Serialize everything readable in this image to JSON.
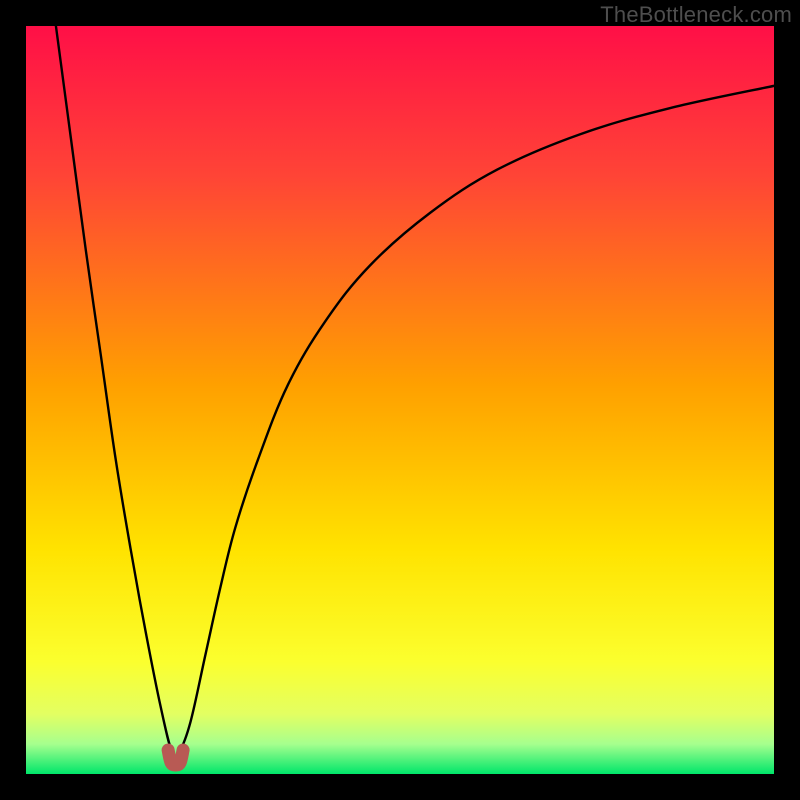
{
  "watermark": "TheBottleneck.com",
  "chart_data": {
    "type": "line",
    "title": "",
    "xlabel": "",
    "ylabel": "",
    "xlim": [
      0,
      100
    ],
    "ylim": [
      0,
      100
    ],
    "grid": false,
    "legend": false,
    "background_gradient_stops": [
      {
        "pct": 0,
        "color": "#ff0f47"
      },
      {
        "pct": 20,
        "color": "#ff4436"
      },
      {
        "pct": 48,
        "color": "#ffa000"
      },
      {
        "pct": 70,
        "color": "#ffe300"
      },
      {
        "pct": 85,
        "color": "#fbff2e"
      },
      {
        "pct": 92,
        "color": "#e3ff62"
      },
      {
        "pct": 96,
        "color": "#a6ff8e"
      },
      {
        "pct": 100,
        "color": "#00e66a"
      }
    ],
    "series": [
      {
        "name": "bottleneck-curve",
        "color": "#000000",
        "x": [
          4,
          6,
          8,
          10,
          12,
          14,
          16,
          18,
          19.5,
          20.5,
          22,
          24,
          26,
          28,
          31,
          35,
          40,
          46,
          54,
          63,
          74,
          86,
          100
        ],
        "y": [
          100,
          85,
          70,
          56,
          42,
          30,
          19,
          9,
          3,
          3,
          7,
          16,
          25,
          33,
          42,
          52,
          60.5,
          68,
          75,
          80.8,
          85.5,
          89,
          92
        ]
      }
    ],
    "valley_marker": {
      "name": "valley-marker",
      "color": "#b85a54",
      "x": [
        19,
        19.4,
        20,
        20.6,
        21
      ],
      "y": [
        3.2,
        1.5,
        1.2,
        1.5,
        3.2
      ]
    }
  }
}
